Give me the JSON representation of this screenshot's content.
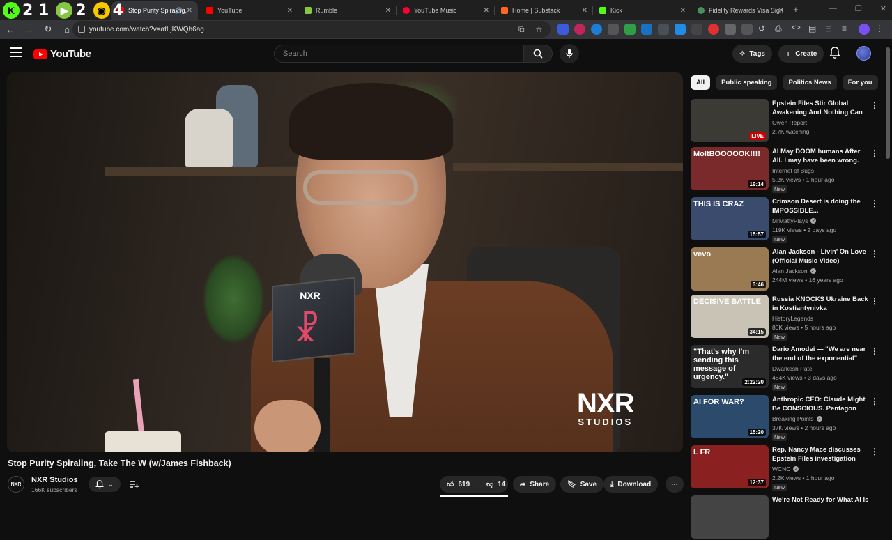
{
  "overlay": {
    "kick_count": "2 1",
    "rumble_count": "2",
    "other_count": "4"
  },
  "tabs": [
    {
      "label": "Stop Purity Spiraling,",
      "color": "#ff0000"
    },
    {
      "label": "YouTube",
      "color": "#ff0000"
    },
    {
      "label": "Rumble",
      "color": "#85c742"
    },
    {
      "label": "YouTube Music",
      "color": "#ff0033"
    },
    {
      "label": "Home | Substack",
      "color": "#ff6719"
    },
    {
      "label": "Kick",
      "color": "#53fc18"
    },
    {
      "label": "Fidelity Rewards Visa Sign",
      "color": "#4a8f5a"
    }
  ],
  "browser": {
    "url": "youtube.com/watch?v=atLjKWQh6ag"
  },
  "youtube": {
    "logo_text": "YouTube",
    "search_placeholder": "Search",
    "tags_label": "Tags",
    "create_label": "Create"
  },
  "video": {
    "title": "Stop Purity Spiraling, Take The W (w/James Fishback)",
    "watermark_big": "NXR",
    "watermark_small": "STUDIOS",
    "mic_logo": "NXR",
    "channel_name": "NXR Studios",
    "channel_avatar_text": "NXR",
    "subscribers": "166K subscribers",
    "likes": "619",
    "dislikes": "14",
    "share_label": "Share",
    "save_label": "Save",
    "download_label": "Download"
  },
  "chips": [
    "All",
    "Public speaking",
    "Politics News",
    "For you"
  ],
  "recommendations": [
    {
      "title": "Epstein Files Stir Global Awakening And Nothing Can ...",
      "channel": "Owen Report",
      "verified": false,
      "meta": "2.7K watching",
      "badge": "LIVE",
      "new": "",
      "bg": "#3b3a35"
    },
    {
      "title": "AI May DOOM humans After All. I may have been wrong.",
      "channel": "Internet of Bugs",
      "verified": false,
      "meta": "5.2K views • 1 hour ago",
      "badge": "19:14",
      "new": "New",
      "bg": "#7a2a2a",
      "thumb_text": "MoltBOOOOOK!!!!"
    },
    {
      "title": "Crimson Desert is doing the IMPOSSIBLE...",
      "channel": "MrMattyPlays",
      "verified": true,
      "meta": "119K views • 2 days ago",
      "badge": "15:57",
      "new": "New",
      "bg": "#3a4b6e",
      "thumb_text": "THIS IS CRAZ"
    },
    {
      "title": "Alan Jackson - Livin' On Love (Official Music Video)",
      "channel": "Alan Jackson",
      "verified": true,
      "meta": "244M views • 16 years ago",
      "badge": "3:46",
      "new": "",
      "bg": "#9a7a52",
      "thumb_text": "vevo"
    },
    {
      "title": "Russia KNOCKS Ukraine Back in Kostiantynivka",
      "channel": "HistoryLegends",
      "verified": false,
      "meta": "80K views • 5 hours ago",
      "badge": "34:15",
      "new": "New",
      "bg": "#c9c3b5",
      "thumb_text": "DECISIVE BATTLE"
    },
    {
      "title": "Dario Amodei — \"We are near the end of the exponential\"",
      "channel": "Dwarkesh Patel",
      "verified": false,
      "meta": "484K views • 3 days ago",
      "badge": "2:22:20",
      "new": "New",
      "bg": "#2b2b2b",
      "thumb_text": "\"That's why I'm sending this message of urgency.\""
    },
    {
      "title": "Anthropic CEO: Claude Might Be CONSCIOUS. Pentagon Alread...",
      "channel": "Breaking Points",
      "verified": true,
      "meta": "37K views • 2 hours ago",
      "badge": "15:20",
      "new": "New",
      "bg": "#2c4a6b",
      "thumb_text": "AI FOR WAR?"
    },
    {
      "title": "Rep. Nancy Mace discusses Epstein Files investigation",
      "channel": "WCNC",
      "verified": true,
      "meta": "2.2K views • 1 hour ago",
      "badge": "12:37",
      "new": "New",
      "bg": "#8a2020",
      "thumb_text": "L FR"
    },
    {
      "title": "We're Not Ready for What AI Is",
      "channel": "",
      "verified": false,
      "meta": "",
      "badge": "",
      "new": "",
      "bg": "#444"
    }
  ]
}
